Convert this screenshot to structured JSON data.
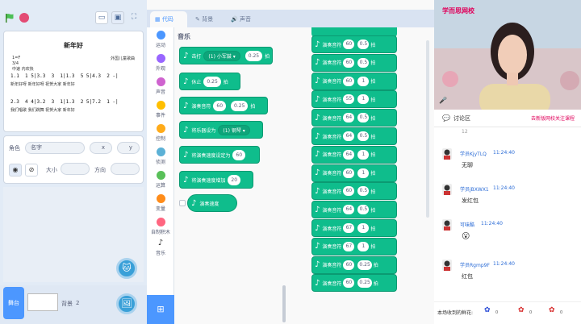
{
  "stage": {
    "title": "新年好",
    "key_line1": "1=F",
    "key_line2": "3/4",
    "key_line3": "中速 内欢快",
    "right_note": "外国儿童歌曲",
    "rows": [
      "1.1  1 5|3.3  3  1|1.3  5 5|4.3  2 -|",
      "2.3  4 4|3.2  3  1|1.3  2 5|7.2  1 -|"
    ],
    "lyrics": [
      "新年好呀 新年好呀 祝贺大家 新年好",
      "我们唱歌 我们跳舞 祝贺大家 新年好"
    ]
  },
  "sprite": {
    "role_label": "角色",
    "name_value": "名字",
    "x_label": "x",
    "y_label": "y",
    "size_label": "大小",
    "direction_label": "方向",
    "show_icon": "eye-icon",
    "hide_icon": "eye-off-icon"
  },
  "bottom": {
    "stage_tab": "舞台",
    "backdrop_label": "背景",
    "backdrop_count": "2"
  },
  "tabs": [
    {
      "label": "代码"
    },
    {
      "label": "背景"
    },
    {
      "label": "声音"
    }
  ],
  "categories": [
    {
      "label": "运动",
      "color": "#4c97ff"
    },
    {
      "label": "外观",
      "color": "#9966ff"
    },
    {
      "label": "声音",
      "color": "#cf63cf"
    },
    {
      "label": "事件",
      "color": "#ffbf00"
    },
    {
      "label": "控制",
      "color": "#ffab19"
    },
    {
      "label": "侦测",
      "color": "#5cb1d6"
    },
    {
      "label": "运算",
      "color": "#59c059"
    },
    {
      "label": "变量",
      "color": "#ff8c1a"
    },
    {
      "label": "自制积木",
      "color": "#ff6680"
    },
    {
      "label": "音乐",
      "color": "#0fbd8c"
    }
  ],
  "palette": {
    "title": "音乐",
    "blocks": [
      {
        "pre": "击打",
        "dd": "(1) 小军鼓 ▾",
        "val": "0.25",
        "post": "拍"
      },
      {
        "pre": "休止",
        "val": "0.25",
        "post": "拍"
      },
      {
        "pre": "演奏音符",
        "val1": "60",
        "val": "0.25",
        "post": "拍"
      },
      {
        "pre": "将乐器设为",
        "dd": "(1) 钢琴 ▾"
      },
      {
        "pre": "将演奏速度设定为",
        "val": "60"
      },
      {
        "pre": "将演奏速度增加",
        "val": "20"
      },
      {
        "pre": "演奏速度"
      }
    ]
  },
  "workspace": {
    "block_label": "演奏音符",
    "beat_label": "拍",
    "notes": [
      {
        "note": "60",
        "beats": "0.5"
      },
      {
        "note": "60",
        "beats": "0.5"
      },
      {
        "note": "60",
        "beats": "1"
      },
      {
        "note": "55",
        "beats": "1"
      },
      {
        "note": "64",
        "beats": "0.5"
      },
      {
        "note": "64",
        "beats": "0.5"
      },
      {
        "note": "64",
        "beats": "1"
      },
      {
        "note": "60",
        "beats": "1"
      },
      {
        "note": "60",
        "beats": "0.5"
      },
      {
        "note": "64",
        "beats": "0.5"
      },
      {
        "note": "67",
        "beats": "1"
      },
      {
        "note": "67",
        "beats": "1"
      },
      {
        "note": "60",
        "beats": "0.25"
      },
      {
        "note": "60",
        "beats": "0.25"
      }
    ]
  },
  "video": {
    "brand": "学而思网校"
  },
  "chat": {
    "title": "讨论区",
    "link": "去新版网校关注课程",
    "first_fragment": "12",
    "messages": [
      {
        "name": "学员KjyTLQ",
        "time": "11:24:40",
        "text": "无聊"
      },
      {
        "name": "学员jBXWX1",
        "time": "11:24:40",
        "text": "发红包"
      },
      {
        "name": "可味酷",
        "time": "11:24:40",
        "text": "😮"
      },
      {
        "name": "学员Rgmp9F",
        "time": "11:24:40",
        "text": "红包"
      }
    ]
  },
  "flowers": {
    "label": "本场收到的鲜花:",
    "counts": [
      "0",
      "0",
      "0"
    ]
  }
}
